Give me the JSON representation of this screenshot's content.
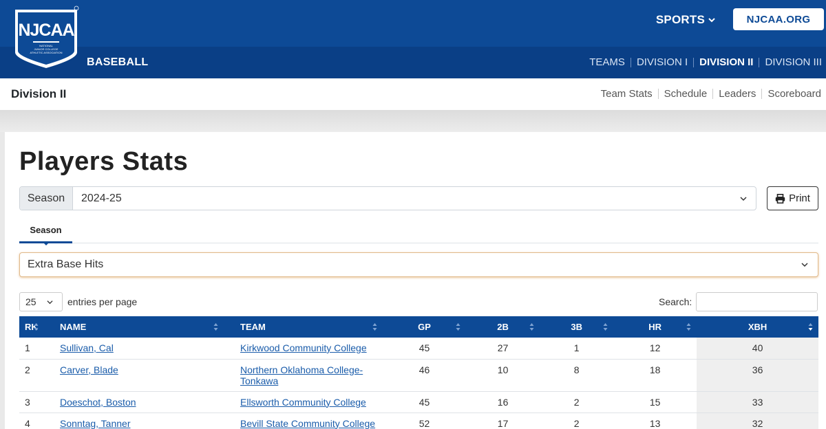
{
  "header": {
    "logo_text": "NJCAA",
    "logo_sub": "NATIONAL JUNIOR COLLEGE ATHLETIC ASSOCIATION",
    "sports_label": "SPORTS",
    "site_button": "NJCAA.ORG",
    "sport_name": "BASEBALL",
    "division_nav": [
      {
        "label": "TEAMS",
        "active": false
      },
      {
        "label": "DIVISION I",
        "active": false
      },
      {
        "label": "DIVISION II",
        "active": true
      },
      {
        "label": "DIVISION III",
        "active": false
      }
    ]
  },
  "subheader": {
    "title": "Division II",
    "links": [
      "Team Stats",
      "Schedule",
      "Leaders",
      "Scoreboard"
    ]
  },
  "main": {
    "title": "Players Stats",
    "season_label": "Season",
    "season_value": "2024-25",
    "print_label": "Print",
    "tab_label": "Season",
    "category_value": "Extra Base Hits",
    "entries_value": "25",
    "entries_label": "entries per page",
    "search_label": "Search:"
  },
  "table": {
    "columns": [
      "RK",
      "NAME",
      "TEAM",
      "GP",
      "2B",
      "3B",
      "HR",
      "XBH"
    ],
    "rows": [
      {
        "rk": "1",
        "name": "Sullivan, Cal",
        "team": "Kirkwood Community College",
        "team2": "",
        "gp": "45",
        "b2": "27",
        "b3": "1",
        "hr": "12",
        "xbh": "40"
      },
      {
        "rk": "2",
        "name": "Carver, Blade",
        "team": "Northern Oklahoma College-",
        "team2": "Tonkawa",
        "gp": "46",
        "b2": "10",
        "b3": "8",
        "hr": "18",
        "xbh": "36"
      },
      {
        "rk": "3",
        "name": "Doeschot, Boston",
        "team": "Ellsworth Community College",
        "team2": "",
        "gp": "45",
        "b2": "16",
        "b3": "2",
        "hr": "15",
        "xbh": "33"
      },
      {
        "rk": "4",
        "name": "Sonntag, Tanner",
        "team": "Bevill State Community College",
        "team2": "",
        "gp": "52",
        "b2": "17",
        "b3": "2",
        "hr": "13",
        "xbh": "32"
      }
    ]
  },
  "colors": {
    "primary": "#0d4a96",
    "nav_dark": "#0a3f86",
    "link": "#1a5caa"
  }
}
